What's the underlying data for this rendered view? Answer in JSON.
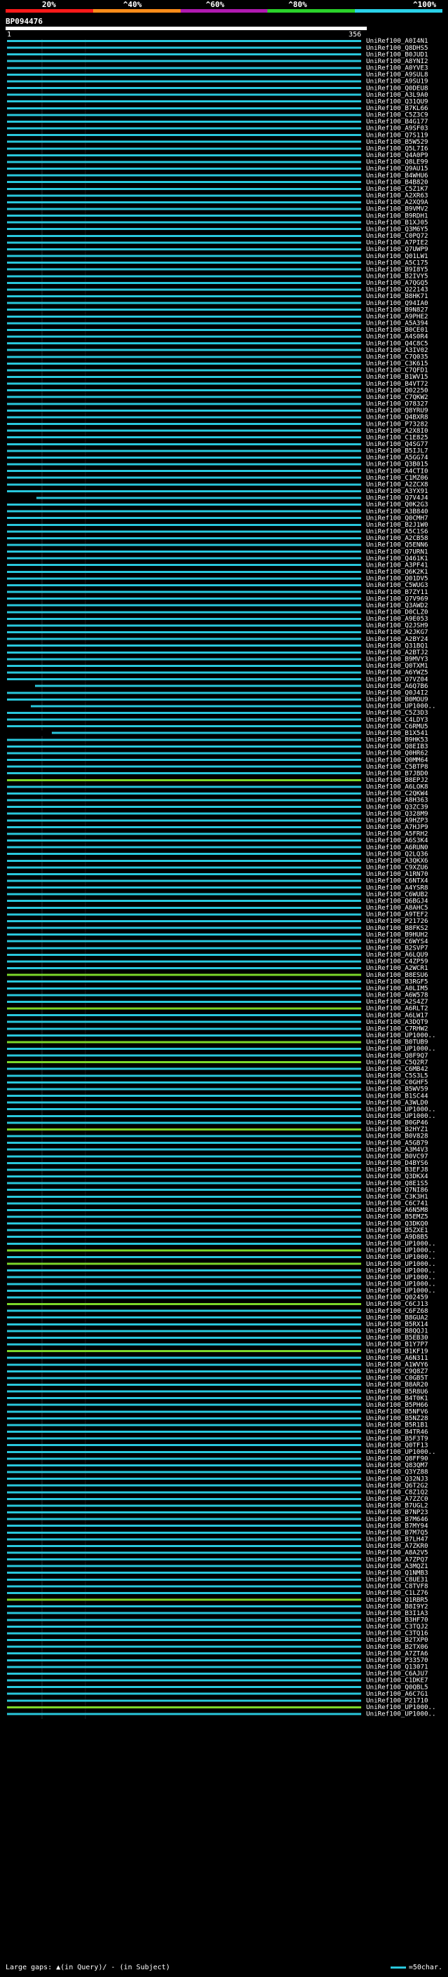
{
  "scale": {
    "ticks": [
      "20%",
      "^40%",
      "^60%",
      "^80%",
      "^100%"
    ],
    "colors": [
      "#ff1a1a",
      "#ff8c1a",
      "#b11ab1",
      "#2ad12a",
      "#2ad1e8"
    ]
  },
  "query": {
    "name": "BP094476",
    "start": "1",
    "end": "356"
  },
  "colors": {
    "hit": "#29c7dc",
    "hit_alt": "#7cd62a",
    "gap": "#000000",
    "cursor_line": "#44545c"
  },
  "hits": [
    "UniRef100_A0I4N1",
    "UniRef100_Q8DHS5",
    "UniRef100_B0JUD1",
    "UniRef100_A8YNI2",
    "UniRef100_A0YVE3",
    "UniRef100_A9SUL8",
    "UniRef100_A9SU19",
    "UniRef100_Q0DEU8",
    "UniRef100_A3L9A0",
    "UniRef100_Q31QU9",
    "UniRef100_B7KL66",
    "UniRef100_C5Z3C9",
    "UniRef100_B4G177",
    "UniRef100_A9SF03",
    "UniRef100_Q7S119",
    "UniRef100_B5W529",
    "UniRef100_Q5L7I6",
    "UniRef100_Q4A0P9",
    "UniRef100_Q8LE99",
    "UniRef100_Q9AU15",
    "UniRef100_B4WHU6",
    "UniRef100_B4B820",
    "UniRef100_C5Z1K7",
    "UniRef100_A2XR63",
    "UniRef100_A2XQ9A",
    "UniRef100_B9VMV2",
    "UniRef100_B9RDH1",
    "UniRef100_B1XJ05",
    "UniRef100_Q3M6Y5",
    "UniRef100_C0PQ72",
    "UniRef100_A7PIE2",
    "UniRef100_Q7UWP9",
    "UniRef100_Q01LW1",
    "UniRef100_A5C175",
    "UniRef100_B9I8Y5",
    "UniRef100_B2IVY5",
    "UniRef100_A7QGQ5",
    "UniRef100_Q22143",
    "UniRef100_B8HK71",
    "UniRef100_Q94IA0",
    "UniRef100_B9N827",
    "UniRef100_A9PHE2",
    "UniRef100_A5A394",
    "UniRef100_B0CE01",
    "UniRef100_A4S0R4",
    "UniRef100_Q4C8C5",
    "UniRef100_A3IV02",
    "UniRef100_C7Q035",
    "UniRef100_C3K615",
    "UniRef100_C7QFD1",
    "UniRef100_B1WV15",
    "UniRef100_B4VT72",
    "UniRef100_Q02250",
    "UniRef100_C7QKW2",
    "UniRef100_O78327",
    "UniRef100_Q8YRU9",
    "UniRef100_Q4BXR8",
    "UniRef100_P73282",
    "UniRef100_A2X8I0",
    "UniRef100_C1E825",
    "UniRef100_Q4SG77",
    "UniRef100_B5IJL7",
    "UniRef100_A5GG74",
    "UniRef100_Q3B015",
    "UniRef100_A4CTI0",
    "UniRef100_C1MZ06",
    "UniRef100_A2ZCX8",
    "UniRef100_A3YX91",
    "UniRef100_Q7V4J4",
    "UniRef100_Q0K2G3",
    "UniRef100_A3B840",
    "UniRef100_Q0CMH7",
    "UniRef100_B2J1W0",
    "UniRef100_A5C1S6",
    "UniRef100_A2CB58",
    "UniRef100_Q5ENN6",
    "UniRef100_Q7URN1",
    "UniRef100_Q461K1",
    "UniRef100_A3PF41",
    "UniRef100_Q6K2K1",
    "UniRef100_Q01DV5",
    "UniRef100_C5WUG3",
    "UniRef100_B7ZY11",
    "UniRef100_Q7V969",
    "UniRef100_Q3AWD2",
    "UniRef100_D0CLZ0",
    "UniRef100_A9E053",
    "UniRef100_Q2JSH9",
    "UniRef100_A2JKG7",
    "UniRef100_A2BY24",
    "UniRef100_Q31BQ1",
    "UniRef100_A2BTJ2",
    "UniRef100_B9MVY3",
    "UniRef100_Q0TXM1",
    "UniRef100_A6YWZ5",
    "UniRef100_O7VZ04",
    "UniRef100_A6Q7B6",
    "UniRef100_Q0J4I2",
    "UniRef100_B0MOU9",
    "UniRef100_UP1000..",
    "UniRef100_C5Z3D3",
    "UniRef100_C4LDY3",
    "UniRef100_C6RMU5",
    "UniRef100_B1X541",
    "UniRef100_B9HK53",
    "UniRef100_Q8EIB3",
    "UniRef100_Q0HR62",
    "UniRef100_Q0MM64",
    "UniRef100_C5BTP8",
    "UniRef100_B7JBD0",
    "UniRef100_B8EPJ2",
    "UniRef100_A6LOK8",
    "UniRef100_C2QKW4",
    "UniRef100_A8H363",
    "UniRef100_Q3ZC39",
    "UniRef100_Q328M9",
    "UniRef100_A9HZP3",
    "UniRef100_A7HJP9",
    "UniRef100_A5FRH2",
    "UniRef100_A6S3K4",
    "UniRef100_A6RUN0",
    "UniRef100_Q2LQ36",
    "UniRef100_A3QKX6",
    "UniRef100_C9XZU6",
    "UniRef100_A1RN70",
    "UniRef100_C6NTX4",
    "UniRef100_A4YSR8",
    "UniRef100_C6WUB2",
    "UniRef100_Q6BGJ4",
    "UniRef100_A8AHC5",
    "UniRef100_A9TEF2",
    "UniRef100_P21726",
    "UniRef100_B8FKS2",
    "UniRef100_B9HUH2",
    "UniRef100_C6WYS4",
    "UniRef100_B2SVP7",
    "UniRef100_A6LQU9",
    "UniRef100_C4ZP59",
    "UniRef100_A2WCR1",
    "UniRef100_B8ESU6",
    "UniRef100_B3RGF5",
    "UniRef100_A0LIM5",
    "UniRef100_A6W578",
    "UniRef100_A2S4Z7",
    "UniRef100_A6RLT2",
    "UniRef100_A6LW17",
    "UniRef100_A3DQT9",
    "UniRef100_C7RHW2",
    "UniRef100_UP1000..",
    "UniRef100_B0TUB9",
    "UniRef100_UP1000..",
    "UniRef100_Q8F9Q7",
    "UniRef100_C5Q2R7",
    "UniRef100_C6MB42",
    "UniRef100_C5S3L5",
    "UniRef100_C0GHF5",
    "UniRef100_B5WV59",
    "UniRef100_B1SC44",
    "UniRef100_A3WLD0",
    "UniRef100_UP1000..",
    "UniRef100_UP1000..",
    "UniRef100_B0GP46",
    "UniRef100_B2HYZ1",
    "UniRef100_B0V828",
    "UniRef100_A5GB79",
    "UniRef100_A3M4V3",
    "UniRef100_B0VC97",
    "UniRef100_D4BYS6",
    "UniRef100_B3EFJ8",
    "UniRef100_Q3DKX4",
    "UniRef100_Q8E1S5",
    "UniRef100_Q7NI86",
    "UniRef100_C3K3H1",
    "UniRef100_C6C741",
    "UniRef100_A6N5M8",
    "UniRef100_B5EMZ5",
    "UniRef100_Q3DKQ0",
    "UniRef100_B5ZXE1",
    "UniRef100_A9D8B5",
    "UniRef100_UP1000..",
    "UniRef100_UP1000..",
    "UniRef100_UP1000..",
    "UniRef100_UP1000..",
    "UniRef100_UP1000..",
    "UniRef100_UP1000..",
    "UniRef100_UP1000..",
    "UniRef100_UP1000..",
    "UniRef100_Q02459",
    "UniRef100_C6CJ13",
    "UniRef100_C6FZ68",
    "UniRef100_B8GUA2",
    "UniRef100_B5RX14",
    "UniRef100_B8QQJ1",
    "UniRef100_B5EB30",
    "UniRef100_B1Y7P7",
    "UniRef100_B1KF19",
    "UniRef100_A6N311",
    "UniRef100_A1WVY6",
    "UniRef100_C9Q8Z7",
    "UniRef100_C0GB5T",
    "UniRef100_B8AR20",
    "UniRef100_B5R8U6",
    "UniRef100_B4T0K1",
    "UniRef100_B5PH66",
    "UniRef100_B5NFV6",
    "UniRef100_B5NZ28",
    "UniRef100_B5R1B1",
    "UniRef100_B4TR46",
    "UniRef100_B5F3T9",
    "UniRef100_Q0TF13",
    "UniRef100_UP1000..",
    "UniRef100_Q8FF90",
    "UniRef100_Q83QM7",
    "UniRef100_Q3YZ88",
    "UniRef100_Q32NJ3",
    "UniRef100_Q6T2G2",
    "UniRef100_C8Z1Q2",
    "UniRef100_A7ZZC0",
    "UniRef100_B7UGL2",
    "UniRef100_B7NP23",
    "UniRef100_B7M646",
    "UniRef100_B7MY94",
    "UniRef100_B7M7Q5",
    "UniRef100_B7LH47",
    "UniRef100_A7ZKR0",
    "UniRef100_A8A2V5",
    "UniRef100_A7ZPQ7",
    "UniRef100_A3MQZ1",
    "UniRef100_Q1NMB3",
    "UniRef100_C8UE31",
    "UniRef100_C8TVF8",
    "UniRef100_C1LZ76",
    "UniRef100_Q1RBR5",
    "UniRef100_B8I9Y2",
    "UniRef100_B3I1A3",
    "UniRef100_B3HF70",
    "UniRef100_C3TQJ2",
    "UniRef100_C3TQ16",
    "UniRef100_B2TXP0",
    "UniRef100_B2TX06",
    "UniRef100_A7ZTA6",
    "UniRef100_P33570",
    "UniRef100_Q13071",
    "UniRef100_C6AJU7",
    "UniRef100_C1DKE7",
    "UniRef100_Q0QBL5",
    "UniRef100_A6C7G1",
    "UniRef100_P21710",
    "UniRef100_UP1000..",
    "UniRef100_UP1000.."
  ],
  "legend": {
    "large_gaps": "Large gaps:",
    "query_gap": "▲(in Query)/",
    "subject_gap": "- (in Subject)",
    "scale_unit": "=50char."
  }
}
